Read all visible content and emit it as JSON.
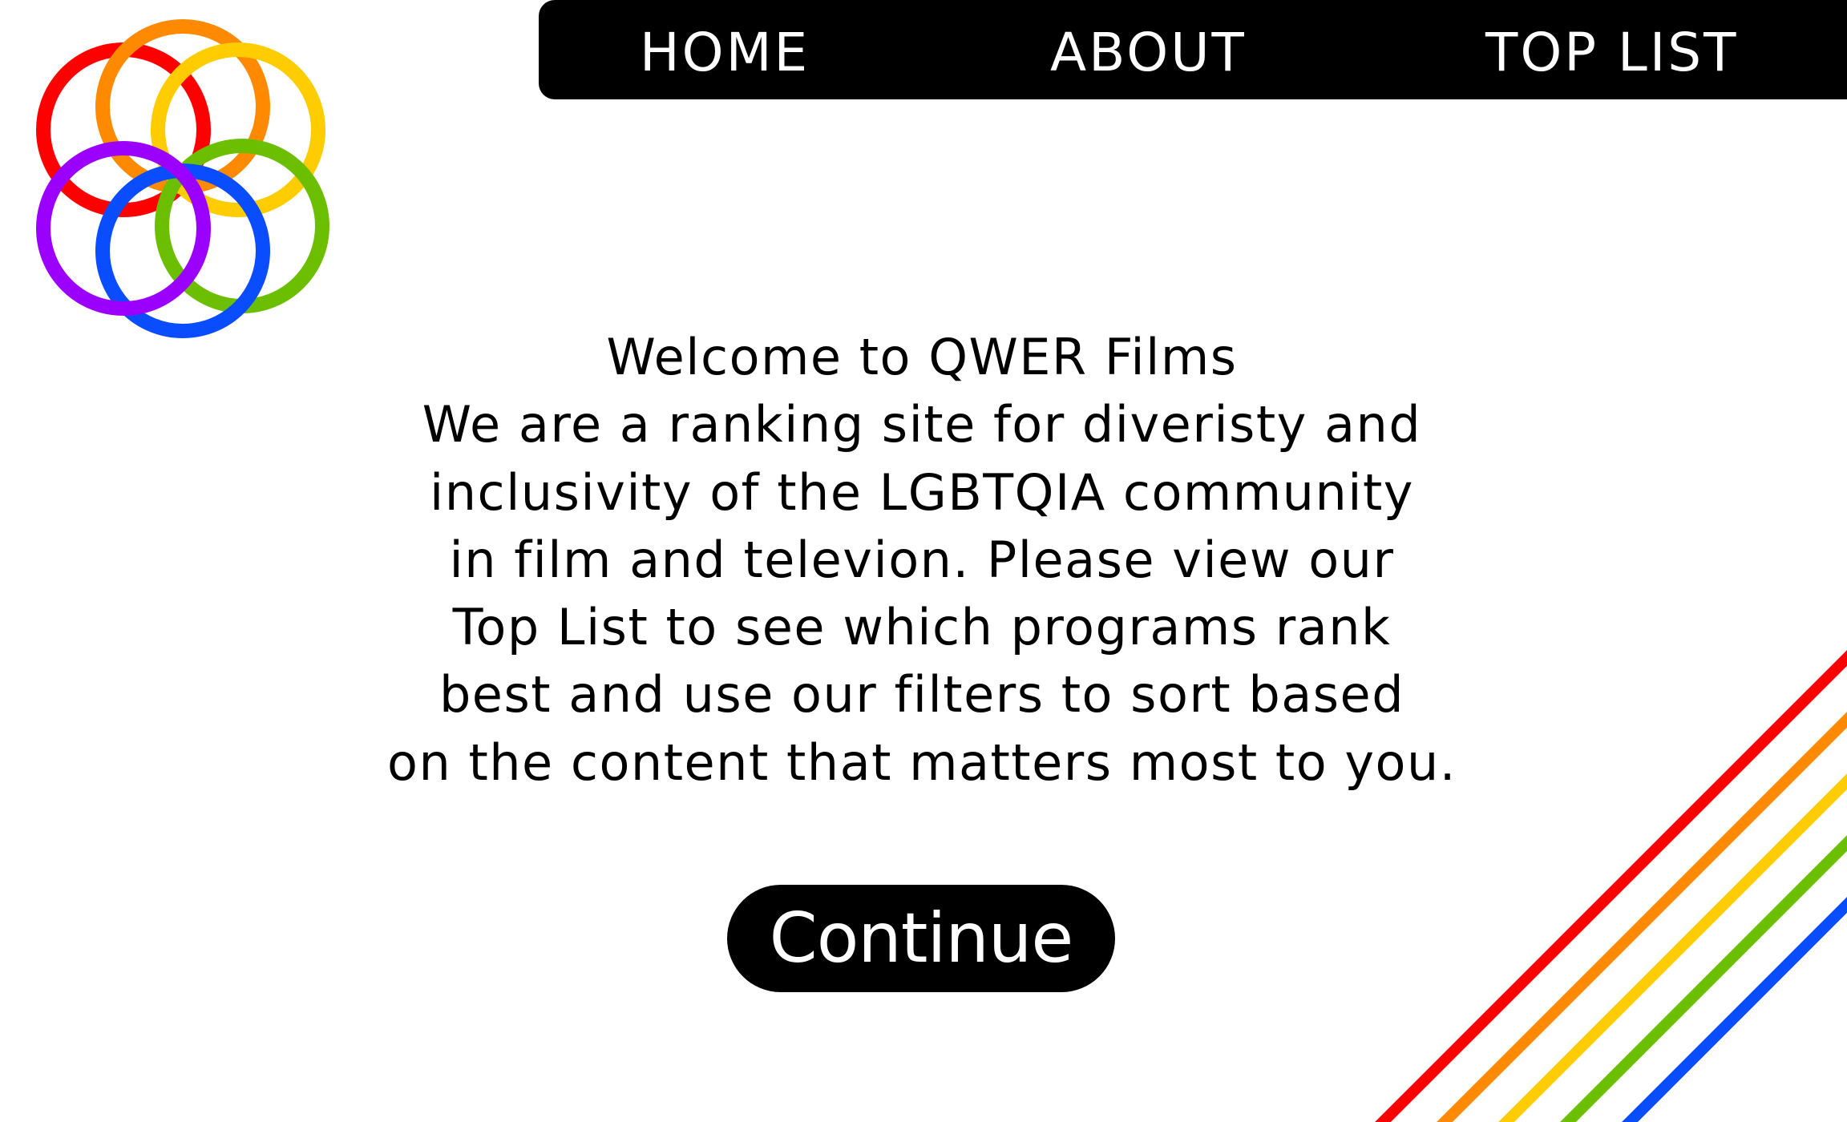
{
  "logo": {
    "icon": "rainbow-rings-logo-icon",
    "colors": [
      "#ff0000",
      "#ff8a00",
      "#ffcc00",
      "#6cbf00",
      "#0a4cff",
      "#9b00ff"
    ]
  },
  "nav": {
    "items": [
      {
        "label": "HOME"
      },
      {
        "label": "ABOUT"
      },
      {
        "label": "TOP LIST"
      }
    ]
  },
  "welcome": {
    "lines": [
      "Welcome to QWER Films",
      "We are a ranking site for diveristy and",
      "inclusivity of the LGBTQIA community",
      "in film and televion. Please view our",
      "Top List to see which programs rank",
      "best and use our filters to sort based",
      "on the content that matters most to you."
    ]
  },
  "continue_button": {
    "label": "Continue"
  },
  "decoration": {
    "icon": "rainbow-stripes",
    "colors": [
      "#ff0000",
      "#ff8a00",
      "#ffcc00",
      "#6cbf00",
      "#0a4cff"
    ]
  },
  "colors": {
    "background": "#ffffff",
    "nav_background": "#000000",
    "nav_text": "#ffffff",
    "button_background": "#000000",
    "button_text": "#ffffff",
    "body_text": "#000000"
  }
}
